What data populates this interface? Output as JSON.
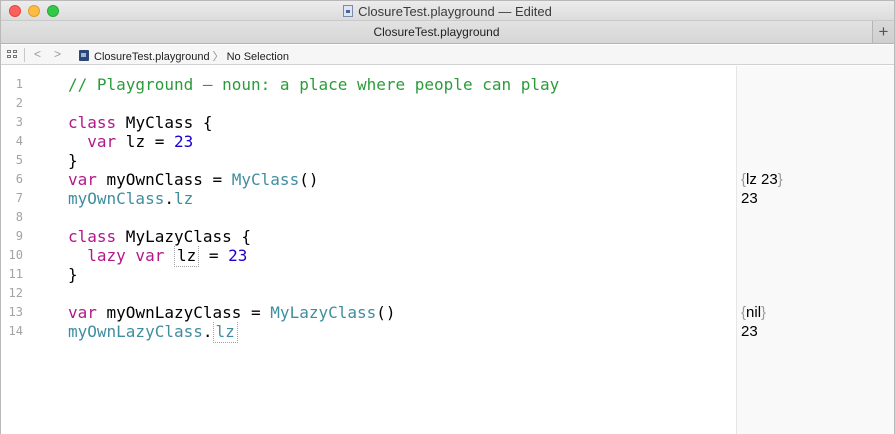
{
  "window": {
    "title": "ClosureTest.playground — Edited"
  },
  "tabbar": {
    "tab_label": "ClosureTest.playground",
    "add_label": "+"
  },
  "jumpbar": {
    "back_glyph": "<",
    "forward_glyph": ">",
    "file_label": "ClosureTest.playground",
    "separator": "〉",
    "selection_label": "No Selection"
  },
  "editor": {
    "line_numbers": [
      "1",
      "2",
      "3",
      "4",
      "5",
      "6",
      "7",
      "8",
      "9",
      "10",
      "11",
      "12",
      "13",
      "14"
    ],
    "lines": {
      "l1": {
        "comment": "// Playground — noun: a place where people can play"
      },
      "l3": {
        "kw": "class",
        "name": " MyClass {"
      },
      "l4": {
        "kw": "  var",
        "name": " lz = ",
        "num": "23"
      },
      "l5": {
        "text": "}"
      },
      "l6": {
        "kw": "var",
        "name": " myOwnClass = ",
        "type": "MyClass",
        "rest": "()"
      },
      "l7": {
        "type": "myOwnClass",
        "rest": ".",
        "prop": "lz"
      },
      "l9": {
        "kw": "class",
        "name": " MyLazyClass {"
      },
      "l10": {
        "kw": "  lazy var",
        "sp": " ",
        "prop": "lz",
        "name": " = ",
        "num": "23"
      },
      "l11": {
        "text": "}"
      },
      "l13": {
        "kw": "var",
        "name": " myOwnLazyClass = ",
        "type": "MyLazyClass",
        "rest": "()"
      },
      "l14": {
        "type": "myOwnLazyClass",
        "rest": ".",
        "prop": "lz"
      }
    },
    "results": {
      "r6": {
        "open": "{",
        "text": "lz 23",
        "close": "}"
      },
      "r7": {
        "text": "23"
      },
      "r13": {
        "open": "{",
        "text": "nil",
        "close": "}"
      },
      "r14": {
        "text": "23"
      }
    }
  },
  "colors": {
    "keyword": "#b21889",
    "comment": "#2b9c3a",
    "number": "#1c00cf",
    "type": "#3f8ea0"
  }
}
